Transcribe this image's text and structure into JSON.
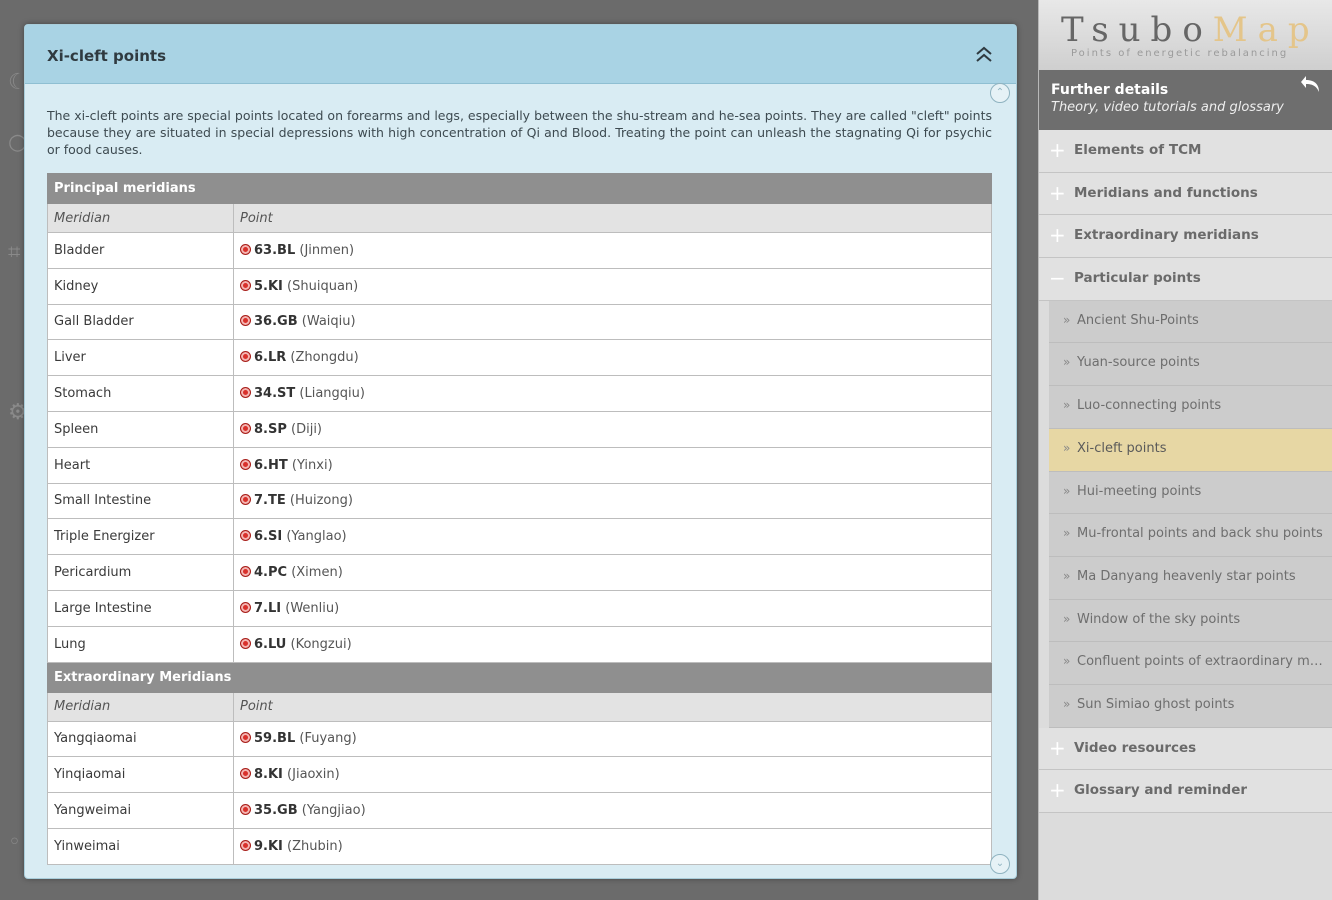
{
  "panel": {
    "title": "Xi-cleft points",
    "intro": "The xi-cleft points are special points located on forearms and legs, especially between the shu-stream and he-sea points. They are called \"cleft\" points because they are situated in special depressions with high concentration of Qi and Blood. Treating the point can unleash the stagnating Qi for psychic or food causes."
  },
  "table": {
    "principal": {
      "title": "Principal meridians",
      "col_meridian": "Meridian",
      "col_point": "Point",
      "rows": [
        {
          "meridian": "Bladder",
          "code": "63.BL",
          "name": "(Jinmen)"
        },
        {
          "meridian": "Kidney",
          "code": "5.KI",
          "name": "(Shuiquan)"
        },
        {
          "meridian": "Gall Bladder",
          "code": "36.GB",
          "name": "(Waiqiu)"
        },
        {
          "meridian": "Liver",
          "code": "6.LR",
          "name": "(Zhongdu)"
        },
        {
          "meridian": "Stomach",
          "code": "34.ST",
          "name": "(Liangqiu)"
        },
        {
          "meridian": "Spleen",
          "code": "8.SP",
          "name": "(Diji)"
        },
        {
          "meridian": "Heart",
          "code": "6.HT",
          "name": "(Yinxi)"
        },
        {
          "meridian": "Small Intestine",
          "code": "7.TE",
          "name": "(Huizong)"
        },
        {
          "meridian": "Triple Energizer",
          "code": "6.SI",
          "name": "(Yanglao)"
        },
        {
          "meridian": "Pericardium",
          "code": "4.PC",
          "name": "(Ximen)"
        },
        {
          "meridian": "Large Intestine",
          "code": "7.LI",
          "name": "(Wenliu)"
        },
        {
          "meridian": "Lung",
          "code": "6.LU",
          "name": "(Kongzui)"
        }
      ]
    },
    "extra": {
      "title": "Extraordinary Meridians",
      "col_meridian": "Meridian",
      "col_point": "Point",
      "rows": [
        {
          "meridian": "Yangqiaomai",
          "code": "59.BL",
          "name": "(Fuyang)"
        },
        {
          "meridian": "Yinqiaomai",
          "code": "8.KI",
          "name": "(Jiaoxin)"
        },
        {
          "meridian": "Yangweimai",
          "code": "35.GB",
          "name": "(Yangjiao)"
        },
        {
          "meridian": "Yinweimai",
          "code": "9.KI",
          "name": "(Zhubin)"
        }
      ]
    }
  },
  "sidebar": {
    "logo_word": "Tsubo",
    "logo_map": "Map",
    "logo_sub": "Points of energetic rebalancing",
    "details_title": "Further details",
    "details_sub": "Theory, video tutorials and glossary",
    "top_items": [
      "Elements of TCM",
      "Meridians and functions",
      "Extraordinary meridians",
      "Particular points",
      "Video resources",
      "Glossary and reminder"
    ],
    "sub_items": [
      "Ancient Shu-Points",
      "Yuan-source points",
      "Luo-connecting points",
      "Xi-cleft points",
      "Hui-meeting points",
      "Mu-frontal points and back shu points",
      "Ma Danyang heavenly star points",
      "Window of the sky points",
      "Confluent points of extraordinary meridians",
      "Sun Simiao ghost points"
    ],
    "active_color": "#e7d7a4"
  }
}
